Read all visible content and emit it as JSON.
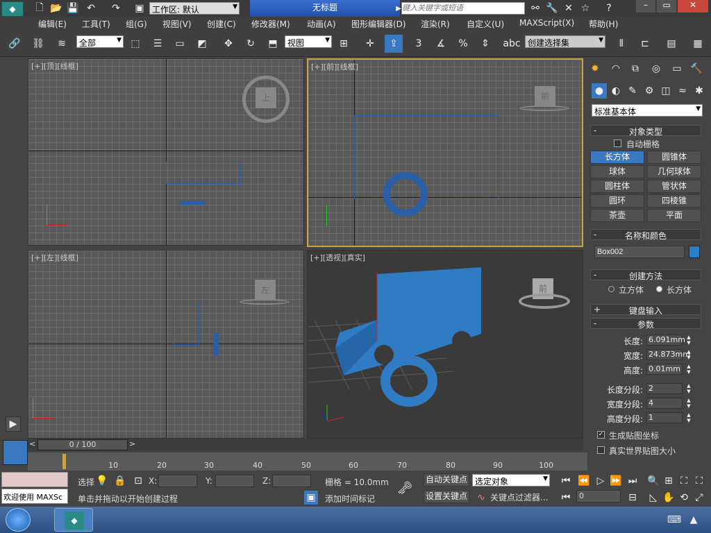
{
  "title": {
    "workspace_label": "工作区: 默认",
    "doc_title": "无标题",
    "search_placeholder": "键入关键字或短语"
  },
  "menu": [
    "编辑(E)",
    "工具(T)",
    "组(G)",
    "视图(V)",
    "创建(C)",
    "修改器(M)",
    "动画(A)",
    "图形编辑器(D)",
    "渲染(R)",
    "自定义(U)",
    "MAXScript(X)",
    "帮助(H)"
  ],
  "toolbar": {
    "filter": "全部",
    "ref_coord": "视图",
    "selection_set": "创建选择集",
    "snap3": "3",
    "snap_pct": "%"
  },
  "viewports": {
    "top": "[+][顶][线框]",
    "front": "[+][前][线框]",
    "left": "[+][左][线框]",
    "persp": "[+][透视][真实]",
    "cube_top": "上",
    "cube_front": "前",
    "cube_left": "左",
    "cube_persp": "前"
  },
  "panel": {
    "category": "标准基本体",
    "object_type": "对象类型",
    "autogrid": "自动栅格",
    "buttons": [
      "长方体",
      "圆锥体",
      "球体",
      "几何球体",
      "圆柱体",
      "管状体",
      "圆环",
      "四棱锥",
      "茶壶",
      "平面"
    ],
    "name_color": "名称和颜色",
    "object_name": "Box002",
    "creation_method": "创建方法",
    "cube": "立方体",
    "box": "长方体",
    "keyboard_entry": "键盘输入",
    "params": "参数",
    "length_lbl": "长度:",
    "length_val": "6.091mm",
    "width_lbl": "宽度:",
    "width_val": "24.873mm",
    "height_lbl": "高度:",
    "height_val": "0.01mm",
    "lseg_lbl": "长度分段:",
    "lseg_val": "2",
    "wseg_lbl": "宽度分段:",
    "wseg_val": "4",
    "hseg_lbl": "高度分段:",
    "hseg_val": "1",
    "gen_map": "生成贴图坐标",
    "real_world": "真实世界贴图大小",
    "color_swatch": "#2a7fc8"
  },
  "timeline": {
    "frame": "0 / 100",
    "ticks": [
      "10",
      "20",
      "30",
      "40",
      "50",
      "60",
      "70",
      "80",
      "90",
      "100"
    ]
  },
  "status": {
    "welcome": "欢迎使用 MAXSc",
    "sel": "选择",
    "x_lbl": "X:",
    "y_lbl": "Y:",
    "z_lbl": "Z:",
    "grid": "栅格 = 10.0mm",
    "prompt": "单击并拖动以开始创建过程",
    "add_tag": "添加时间标记",
    "auto_key": "自动关键点",
    "set_key": "设置关键点",
    "selected": "选定对象",
    "key_filters": "关键点过滤器...",
    "frame_field": "0"
  }
}
